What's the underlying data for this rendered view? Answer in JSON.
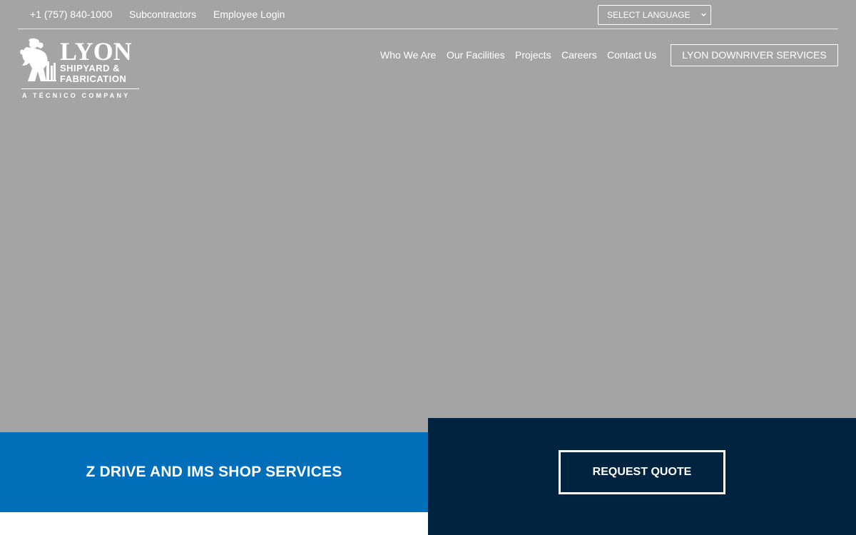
{
  "topbar": {
    "phone": "+1 (757) 840-1000",
    "subcontractors": "Subcontractors",
    "employee_login": "Employee Login",
    "language_select": "SELECT LANGUAGE"
  },
  "logo": {
    "main": "LYON",
    "line1": "SHIPYARD &",
    "line2": "FABRICATION",
    "tagline": "A TÉCNICO COMPANY"
  },
  "nav": {
    "items": [
      {
        "label": "Who We Are"
      },
      {
        "label": "Our Facilities"
      },
      {
        "label": "Projects"
      },
      {
        "label": "Careers"
      },
      {
        "label": "Contact Us"
      }
    ],
    "cta": "LYON DOWNRIVER SERVICES"
  },
  "service": {
    "title": "Z DRIVE AND IMS SHOP SERVICES"
  },
  "quote": {
    "button": "REQUEST QUOTE"
  },
  "colors": {
    "hero_bg": "#a4a4a4",
    "service_blue": "#006eb9",
    "navy": "#002440",
    "white": "#ffffff"
  }
}
